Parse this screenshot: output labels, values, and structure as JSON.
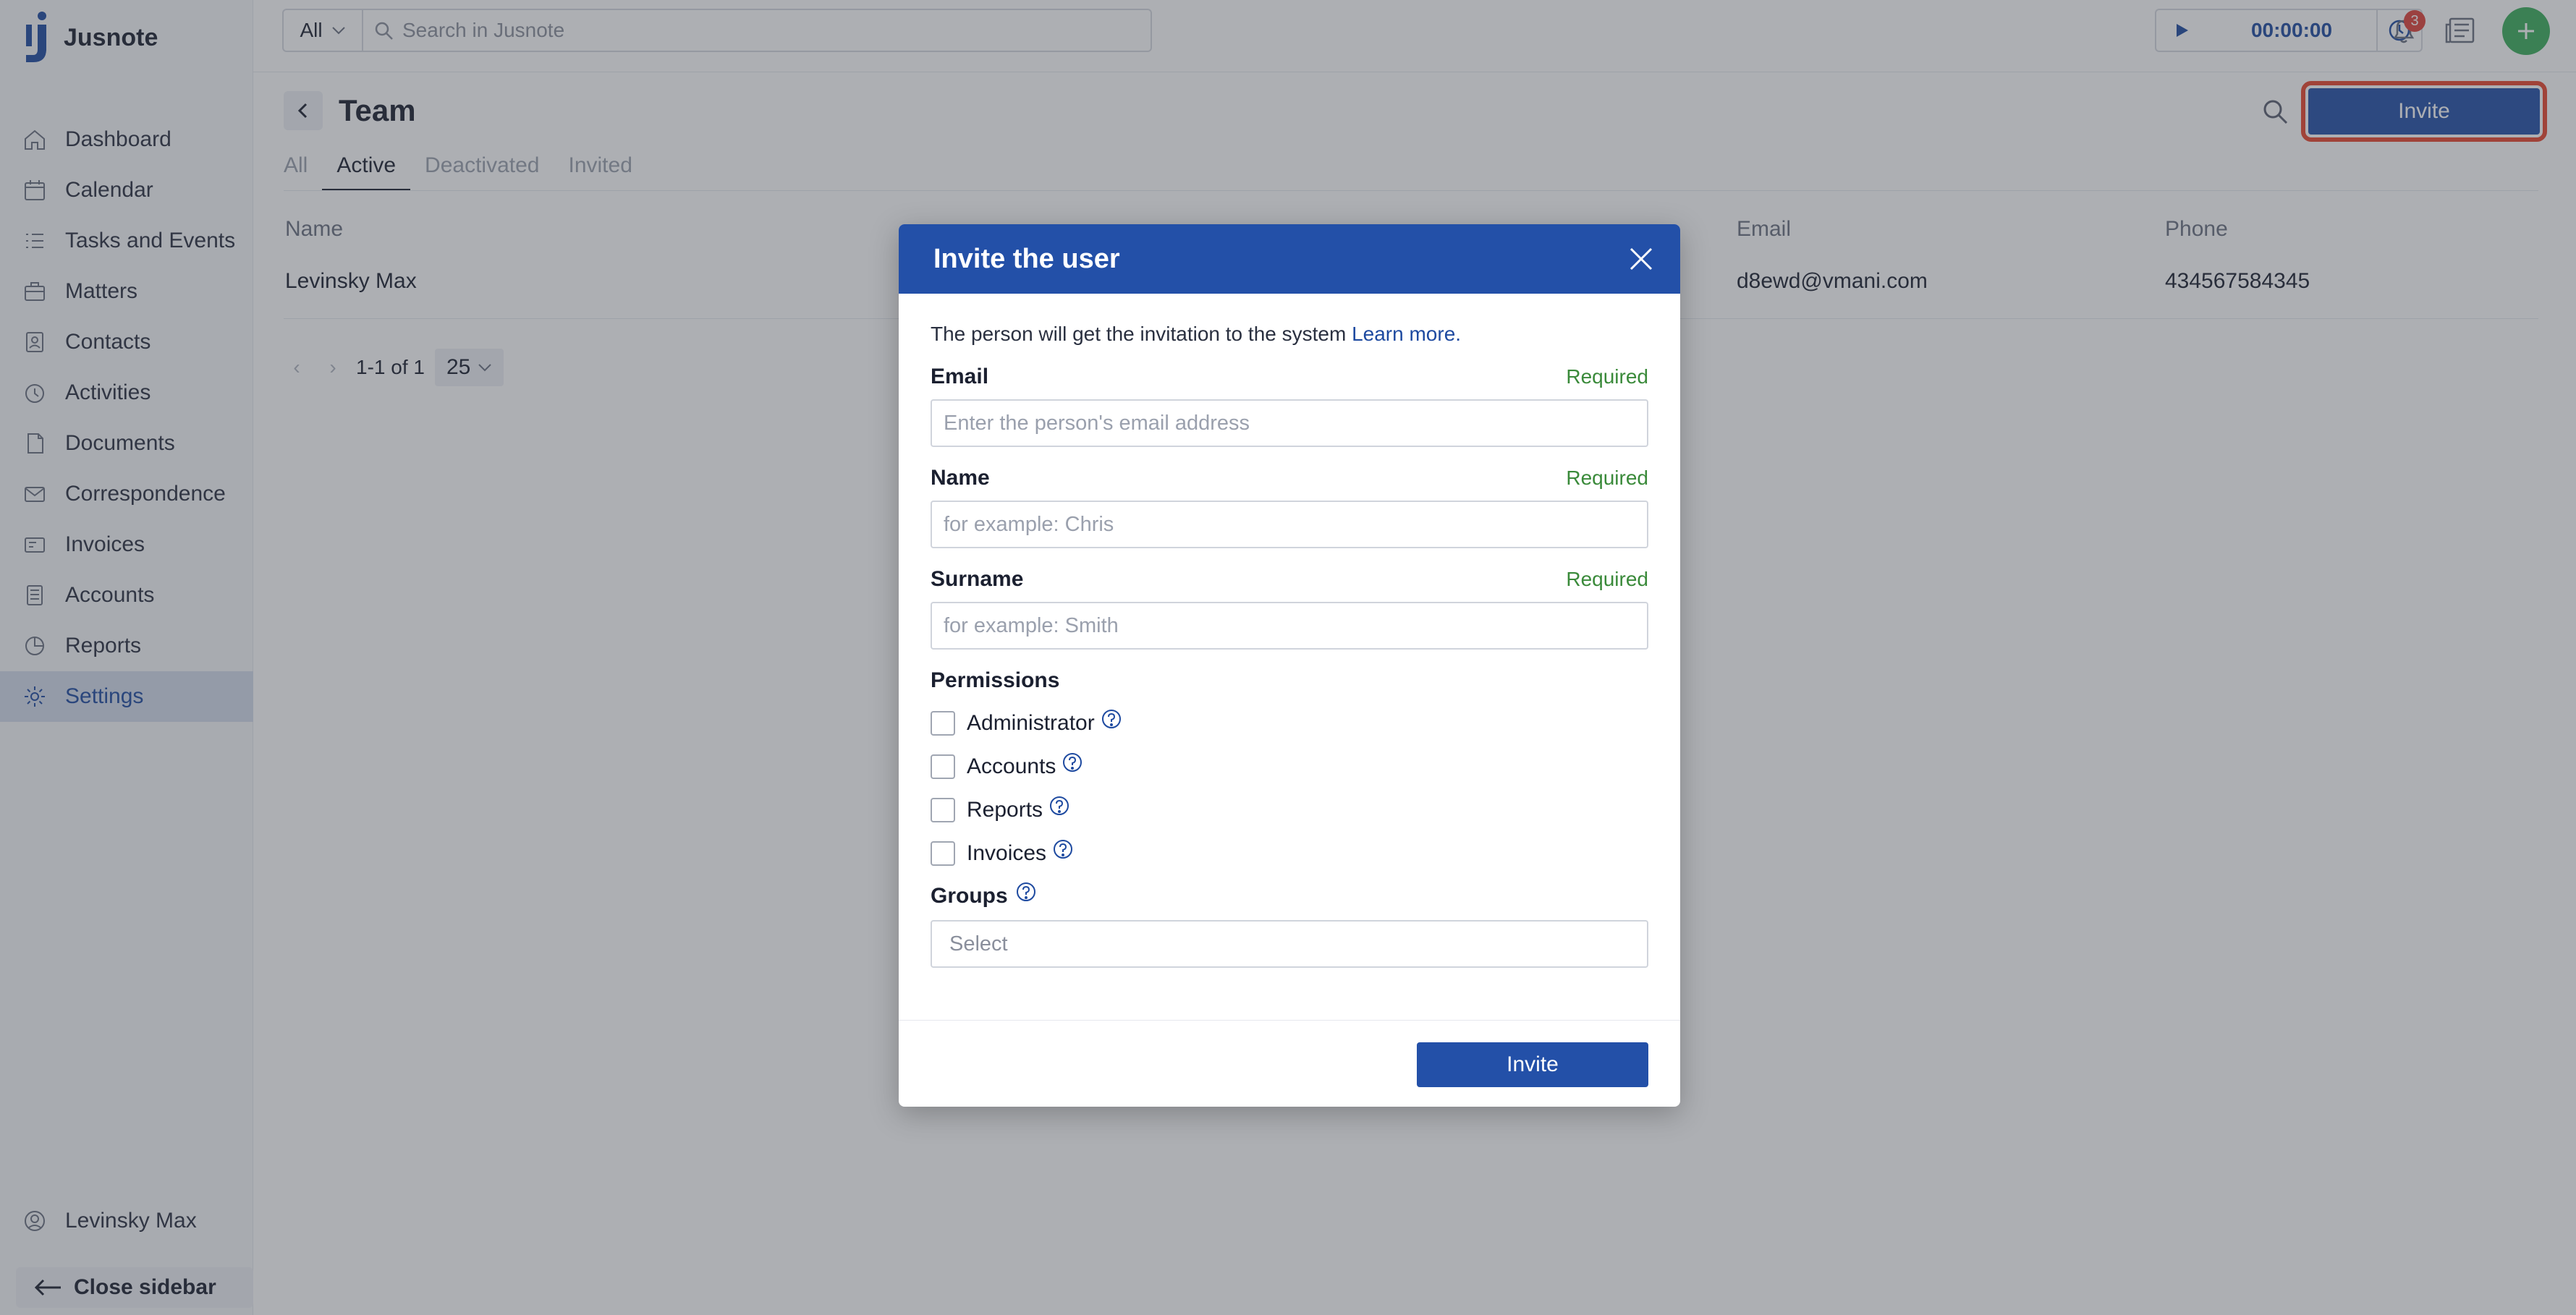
{
  "app": {
    "name": "Jusnote"
  },
  "sidebar": {
    "items": [
      {
        "label": "Dashboard",
        "icon": "home-icon"
      },
      {
        "label": "Calendar",
        "icon": "calendar-icon"
      },
      {
        "label": "Tasks and Events",
        "icon": "tasks-icon"
      },
      {
        "label": "Matters",
        "icon": "matters-icon"
      },
      {
        "label": "Contacts",
        "icon": "contacts-icon"
      },
      {
        "label": "Activities",
        "icon": "activities-icon"
      },
      {
        "label": "Documents",
        "icon": "documents-icon"
      },
      {
        "label": "Correspondence",
        "icon": "correspondence-icon"
      },
      {
        "label": "Invoices",
        "icon": "invoices-icon"
      },
      {
        "label": "Accounts",
        "icon": "accounts-icon"
      },
      {
        "label": "Reports",
        "icon": "reports-icon"
      },
      {
        "label": "Settings",
        "icon": "gear-icon",
        "active": true
      }
    ],
    "user": "Levinsky Max",
    "close_label": "Close sidebar"
  },
  "topbar": {
    "scope": "All",
    "search_placeholder": "Search in Jusnote",
    "timer": "00:00:00",
    "notifications_count": "3"
  },
  "page": {
    "title": "Team",
    "invite_label": "Invite",
    "tabs": [
      "All",
      "Active",
      "Deactivated",
      "Invited"
    ],
    "active_tab": "Active"
  },
  "table": {
    "columns": {
      "name": "Name",
      "email": "Email",
      "phone": "Phone"
    },
    "rows": [
      {
        "name": "Levinsky Max",
        "email": "d8ewd@vmani.com",
        "phone": "434567584345"
      }
    ],
    "pagination": {
      "range": "1-1 of 1",
      "page_size": "25"
    }
  },
  "modal": {
    "title": "Invite the user",
    "intro": "The person will get the invitation to the system",
    "learn_more": "Learn more.",
    "required_label": "Required",
    "email_label": "Email",
    "email_placeholder": "Enter the person's email address",
    "name_label": "Name",
    "name_placeholder": "for example: Chris",
    "surname_label": "Surname",
    "surname_placeholder": "for example: Smith",
    "permissions_label": "Permissions",
    "permissions": [
      "Administrator",
      "Accounts",
      "Reports",
      "Invoices"
    ],
    "groups_label": "Groups",
    "groups_placeholder": "Select",
    "submit_label": "Invite"
  },
  "colors": {
    "primary": "#2350a8",
    "required": "#3a8a3a",
    "highlight": "#e8452e",
    "add_button": "#3cae5c"
  }
}
